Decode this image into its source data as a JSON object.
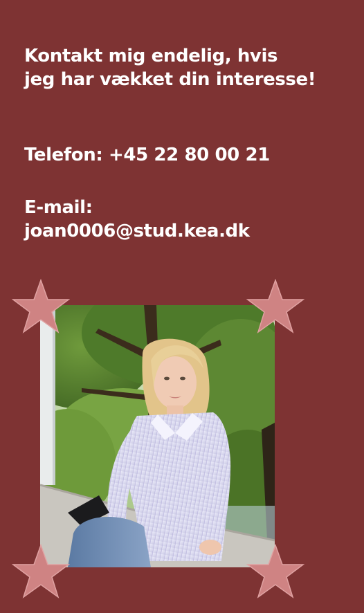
{
  "contact": {
    "heading_line1": "Kontakt mig endelig, hvis",
    "heading_line2": "jeg har vækket din interesse!",
    "phone": "Telefon: +45 22 80 00 21",
    "email_label": "E-mail:",
    "email": "joan0006@stud.kea.dk"
  },
  "photo": {
    "subject": "portrait-photo"
  },
  "decorations": {
    "star_icon": "star-icon",
    "star_color": "#cf8383",
    "star_stroke": "#e0a2a2"
  },
  "colors": {
    "background": "#7e3333",
    "text": "#ffffff"
  }
}
